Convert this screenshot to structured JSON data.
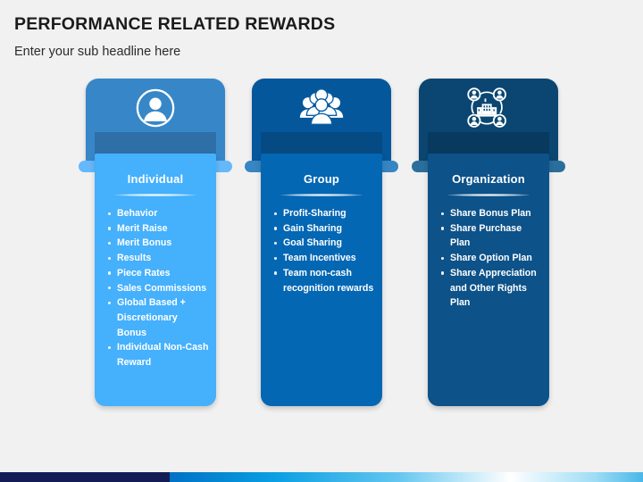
{
  "slide": {
    "headline": "PERFORMANCE RELATED REWARDS",
    "subheadline": "Enter your sub headline here"
  },
  "theme": {
    "background": "#f1f1f1",
    "headline_color": "#1b1b1b",
    "footer_navy": "#141c55",
    "footer_gradient_start": "#0071c5",
    "footer_gradient_end": "#49b7e8"
  },
  "columns": [
    {
      "title": "Individual",
      "icon": "person-circle-icon",
      "colors": {
        "header": "#3787c8",
        "notch": "#2f6fa8",
        "shoulder": "#65b8fb",
        "body": "#45b0fc"
      },
      "items": [
        "Behavior",
        "Merit Raise",
        "Merit Bonus",
        "Results",
        "Piece Rates",
        "Sales Commissions",
        "Global Based + Discretionary Bonus",
        "Individual Non-Cash Reward"
      ]
    },
    {
      "title": "Group",
      "icon": "people-group-icon",
      "colors": {
        "header": "#05579c",
        "notch": "#064a84",
        "shoulder": "#3785c2",
        "body": "#0467b4"
      },
      "items": [
        "Profit-Sharing",
        "Gain Sharing",
        "Goal Sharing",
        "Team Incentives",
        "Team non-cash recognition rewards"
      ]
    },
    {
      "title": "Organization",
      "icon": "organization-network-icon",
      "colors": {
        "header": "#0a4671",
        "notch": "#083a5f",
        "shoulder": "#2a6f9c",
        "body": "#0d5289"
      },
      "items": [
        "Share Bonus Plan",
        "Share Purchase Plan",
        "Share Option Plan",
        "Share Appreciation and Other Rights Plan"
      ]
    }
  ]
}
